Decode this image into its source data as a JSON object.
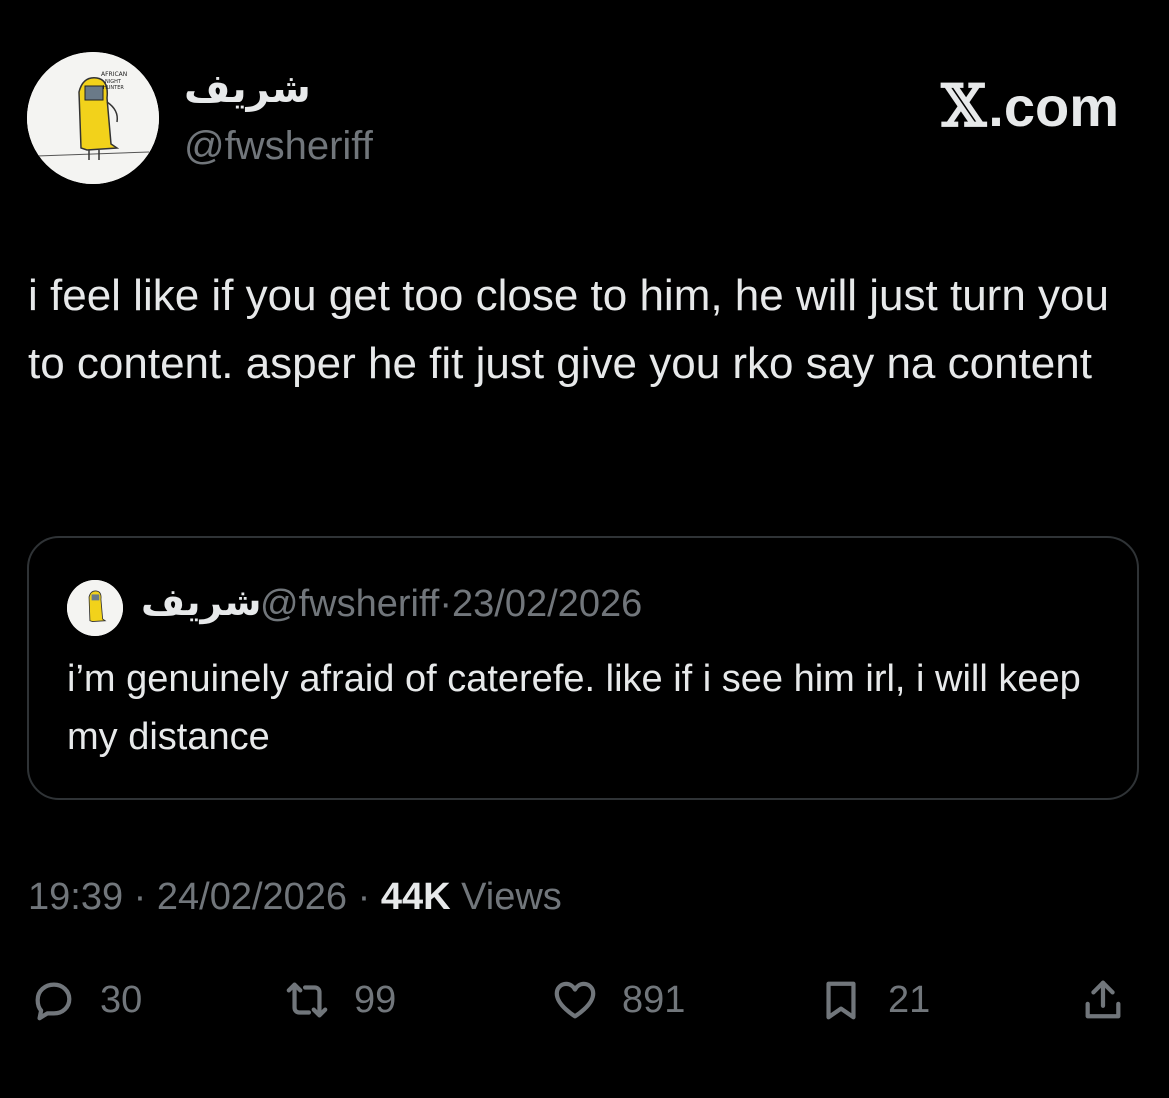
{
  "tweet": {
    "display_name": "شريف",
    "handle": "@fwsheriff",
    "brand": "X.com",
    "body": "i feel like if you get too close to him, he will just turn you to content. asper he fit just give you rko say na content",
    "time": "19:39",
    "date": "24/02/2026",
    "separator": "·",
    "views_count": "44K",
    "views_label": "Views"
  },
  "quoted": {
    "display_name": "شريف",
    "handle": "@fwsheriff",
    "separator": "·",
    "date": "23/02/2026",
    "body": "i’m genuinely afraid of caterefe. like if i see him irl, i will keep my distance"
  },
  "actions": {
    "replies": "30",
    "reposts": "99",
    "likes": "891",
    "bookmarks": "21"
  },
  "icons": [
    "reply-icon",
    "repost-icon",
    "like-icon",
    "bookmark-icon",
    "share-icon"
  ],
  "colors": {
    "background": "#000000",
    "text": "#e7e9ea",
    "muted": "#71767b",
    "border": "#2f3336",
    "avatar_yellow": "#f2d21b"
  }
}
